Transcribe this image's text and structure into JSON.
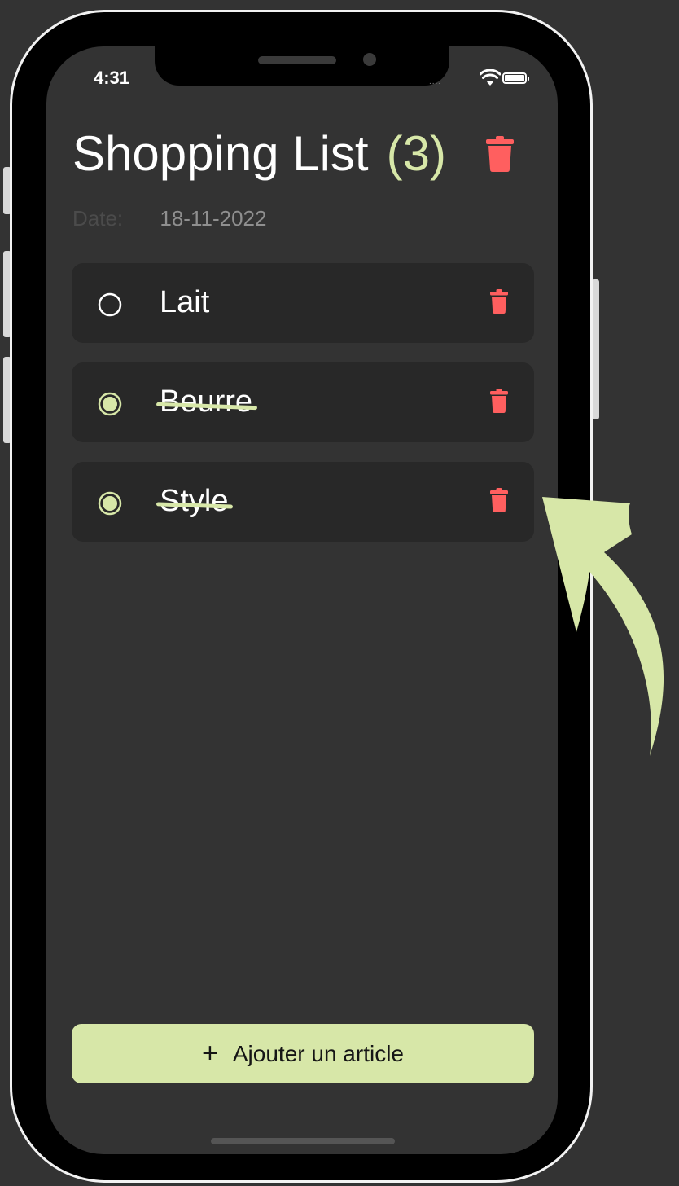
{
  "status": {
    "time": "4:31",
    "signal_dots": "....",
    "wifi_icon": "wifi-icon",
    "battery_icon": "battery-icon"
  },
  "header": {
    "title": "Shopping List",
    "count": "(3)",
    "delete_all_icon": "trash-icon"
  },
  "date": {
    "label": "Date:",
    "value": "18-11-2022"
  },
  "items": [
    {
      "label": "Lait",
      "checked": false
    },
    {
      "label": "Beurre",
      "checked": true
    },
    {
      "label": "Style",
      "checked": true
    }
  ],
  "add_button": {
    "icon": "+",
    "label": "Ajouter un article"
  },
  "colors": {
    "accent": "#d7e7a8",
    "danger": "#ff5f5f",
    "background": "#333333",
    "card": "#282828"
  }
}
